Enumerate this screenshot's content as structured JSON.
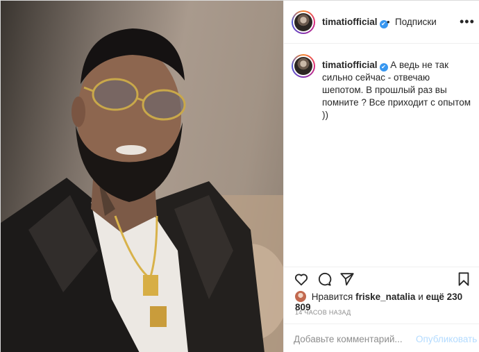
{
  "post": {
    "username": "timatiofficial",
    "verified_mark": "✔",
    "separator": "•",
    "follow_label": "Подписки",
    "more_label": "•••",
    "caption_username": "timatiofficial",
    "caption_text": "А ведь не так сильно сейчас - отвечаю шепотом. В прошлый раз вы помните ? Все приходит с опытом ))",
    "likes_prefix": "Нравится",
    "liked_by": "friske_natalia",
    "likes_middle": "и",
    "likes_count": "ещё 230 809",
    "timestamp": "14 ЧАСОВ НАЗАД"
  },
  "icons": [
    "heart-icon",
    "comment-icon",
    "share-icon",
    "bookmark-icon"
  ],
  "comment": {
    "placeholder": "Добавьте комментарий...",
    "publish_label": "Опубликовать"
  },
  "colors": {
    "verified": "#3897f0",
    "publish_disabled": "#b3dbff",
    "muted_text": "#8e8e8e"
  }
}
